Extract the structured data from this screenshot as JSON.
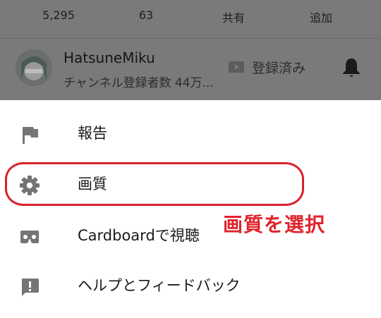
{
  "stats": {
    "views": "5,295",
    "likes": "63",
    "share": "共有",
    "add": "追加"
  },
  "channel": {
    "name": "HatsuneMiku",
    "subscribers": "チャンネル登録者数 44万...",
    "subscribe_state": "登録済み"
  },
  "menu": {
    "items": [
      {
        "label": "報告",
        "icon": "flag-icon"
      },
      {
        "label": "画質",
        "icon": "gear-icon"
      },
      {
        "label": "Cardboardで視聴",
        "icon": "cardboard-icon"
      },
      {
        "label": "ヘルプとフィードバック",
        "icon": "feedback-icon"
      }
    ]
  },
  "annotation": {
    "text": "画質を選択",
    "color": "#e0242c"
  },
  "colors": {
    "overlay": "#7a7a7a",
    "icon_gray": "#757575",
    "highlight": "#d8222a"
  }
}
